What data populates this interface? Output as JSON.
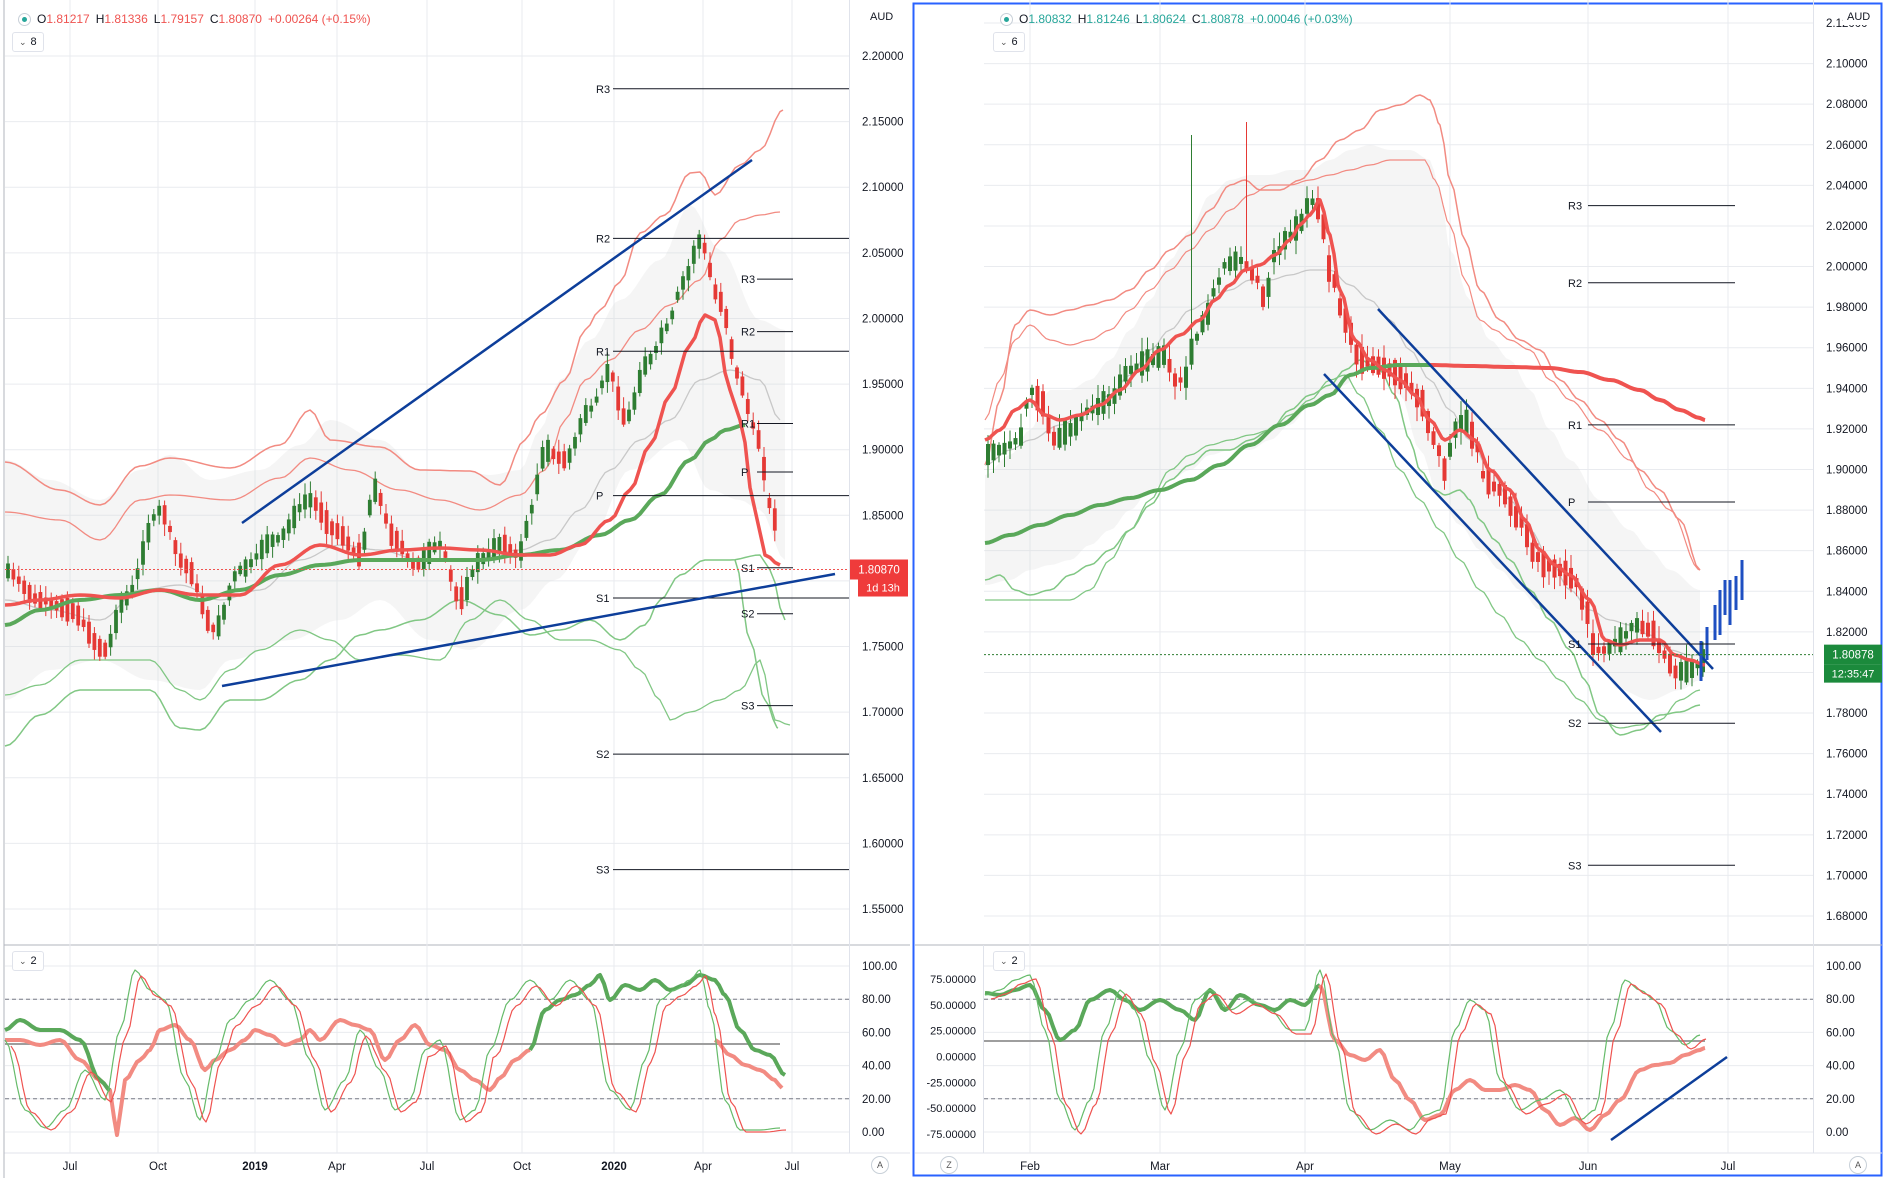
{
  "left": {
    "ohlc": {
      "o": "1.81217",
      "h": "1.81336",
      "l": "1.79157",
      "c": "1.80870",
      "chg": "+0.00264 (+0.15%)"
    },
    "interval_badge": "8",
    "indicator_badge": "2",
    "currency": "AUD",
    "price_tag": "1.80870",
    "time_tag": "1d 13h",
    "price_axis": [
      "2.20000",
      "2.15000",
      "2.10000",
      "2.05000",
      "2.00000",
      "1.95000",
      "1.90000",
      "1.85000",
      "1.80000",
      "1.75000",
      "1.70000",
      "1.65000",
      "1.60000",
      "1.55000"
    ],
    "osc_axis": [
      "100.00",
      "80.00",
      "60.00",
      "40.00",
      "20.00",
      "0.00"
    ],
    "time_axis": [
      "Jul",
      "Oct",
      "2019",
      "Apr",
      "Jul",
      "Oct",
      "2020",
      "Apr",
      "Jul"
    ],
    "pivot_labels_big": [
      "R3",
      "R2",
      "R1",
      "P",
      "S1",
      "S2",
      "S3"
    ],
    "pivot_labels_small": [
      "R3",
      "R2",
      "R1",
      "P",
      "S1",
      "S2",
      "S3"
    ],
    "corner_a": "A"
  },
  "right": {
    "ohlc": {
      "o": "1.80832",
      "h": "1.81246",
      "l": "1.80624",
      "c": "1.80878",
      "chg": "+0.00046 (+0.03%)"
    },
    "interval_badge": "6",
    "indicator_badge": "2",
    "currency": "AUD",
    "price_tag": "1.80878",
    "time_tag": "12:35:47",
    "price_axis": [
      "2.12000",
      "2.10000",
      "2.08000",
      "2.06000",
      "2.04000",
      "2.02000",
      "2.00000",
      "1.98000",
      "1.96000",
      "1.94000",
      "1.92000",
      "1.90000",
      "1.88000",
      "1.86000",
      "1.84000",
      "1.82000",
      "1.80000",
      "1.78000",
      "1.76000",
      "1.74000",
      "1.72000",
      "1.70000",
      "1.68000"
    ],
    "osc_axis": [
      "100.00",
      "80.00",
      "60.00",
      "40.00",
      "20.00",
      "0.00"
    ],
    "osc_left_axis": [
      "75.00000",
      "50.00000",
      "25.00000",
      "0.00000",
      "-25.00000",
      "-50.00000",
      "-75.00000"
    ],
    "time_axis": [
      "Feb",
      "Mar",
      "Apr",
      "May",
      "Jun",
      "Jul"
    ],
    "pivot_labels": [
      "R3",
      "R2",
      "R1",
      "P",
      "S1",
      "S2",
      "S3"
    ],
    "corner_a": "A",
    "corner_z": "Z"
  },
  "colors": {
    "up": "#2e7d32",
    "down": "#e53935",
    "ema_red": "#ef5350",
    "ema_green": "#5aa85a",
    "band_red": "#f28b82",
    "band_green": "#81c784",
    "trend": "#0d3e9a",
    "grid": "#e9ebef",
    "accent": "#2962ff"
  }
}
